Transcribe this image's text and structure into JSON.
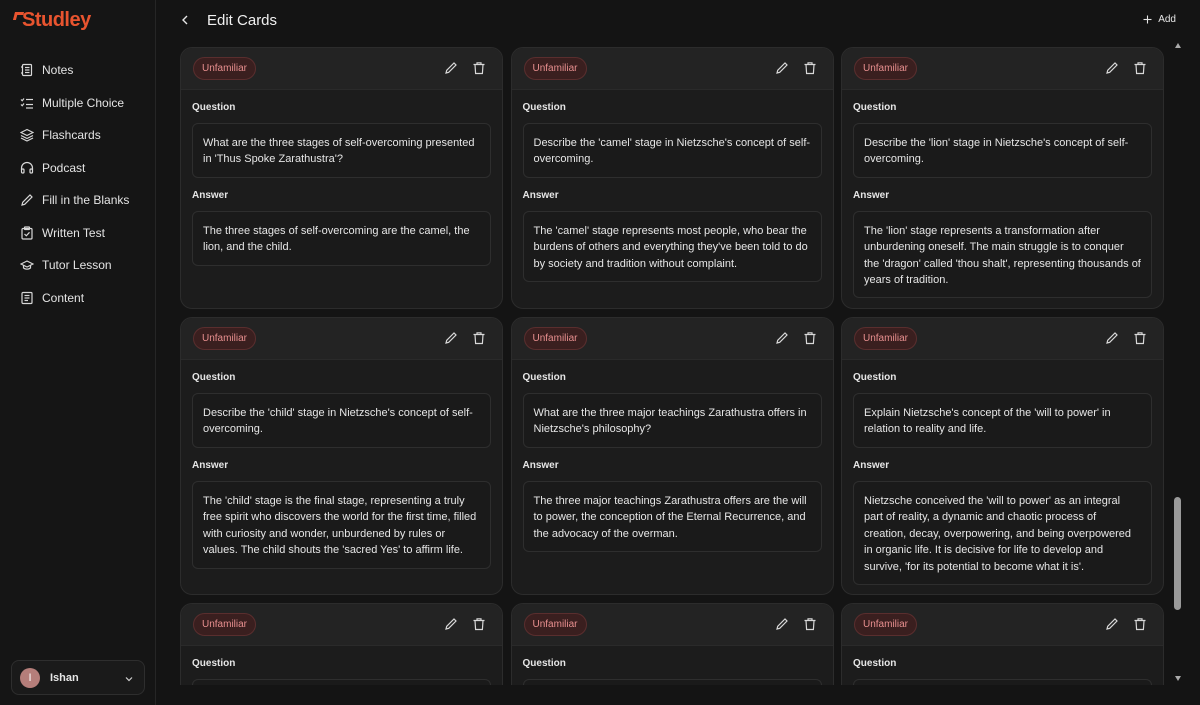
{
  "app": {
    "logo_text": "Studley"
  },
  "sidebar": {
    "items": [
      {
        "label": "Notes",
        "icon": "notes-icon"
      },
      {
        "label": "Multiple Choice",
        "icon": "checklist-icon"
      },
      {
        "label": "Flashcards",
        "icon": "layers-icon"
      },
      {
        "label": "Podcast",
        "icon": "headphones-icon"
      },
      {
        "label": "Fill in the Blanks",
        "icon": "pencil-icon"
      },
      {
        "label": "Written Test",
        "icon": "clipboard-check-icon"
      },
      {
        "label": "Tutor Lesson",
        "icon": "graduation-cap-icon"
      },
      {
        "label": "Content",
        "icon": "document-icon"
      }
    ],
    "user": {
      "initial": "I",
      "name": "Ishan"
    }
  },
  "header": {
    "title": "Edit Cards",
    "add_label": "Add"
  },
  "labels": {
    "question": "Question",
    "answer": "Answer"
  },
  "colors": {
    "accent": "#e8542f",
    "badge_bg": "#3a1f1f",
    "badge_text": "#e88f8f"
  },
  "cards": [
    {
      "status": "Unfamiliar",
      "question": "What are the three stages of self-overcoming presented in 'Thus Spoke Zarathustra'?",
      "answer": "The three stages of self-overcoming are the camel, the lion, and the child."
    },
    {
      "status": "Unfamiliar",
      "question": "Describe the 'camel' stage in Nietzsche's concept of self-overcoming.",
      "answer": "The 'camel' stage represents most people, who bear the burdens of others and everything they've been told to do by society and tradition without complaint."
    },
    {
      "status": "Unfamiliar",
      "question": "Describe the 'lion' stage in Nietzsche's concept of self-overcoming.",
      "answer": "The 'lion' stage represents a transformation after unburdening oneself. The main struggle is to conquer the 'dragon' called 'thou shalt', representing thousands of years of tradition."
    },
    {
      "status": "Unfamiliar",
      "question": "Describe the 'child' stage in Nietzsche's concept of self-overcoming.",
      "answer": "The 'child' stage is the final stage, representing a truly free spirit who discovers the world for the first time, filled with curiosity and wonder, unburdened by rules or values. The child shouts the 'sacred Yes' to affirm life."
    },
    {
      "status": "Unfamiliar",
      "question": "What are the three major teachings Zarathustra offers in Nietzsche's philosophy?",
      "answer": "The three major teachings Zarathustra offers are the will to power, the conception of the Eternal Recurrence, and the advocacy of the overman."
    },
    {
      "status": "Unfamiliar",
      "question": "Explain Nietzsche's concept of the 'will to power' in relation to reality and life.",
      "answer": "Nietzsche conceived the 'will to power' as an integral part of reality, a dynamic and chaotic process of creation, decay, overpowering, and being overpowered in organic life. It is decisive for life to develop and survive, 'for its potential to become what it is'."
    },
    {
      "status": "Unfamiliar"
    },
    {
      "status": "Unfamiliar"
    },
    {
      "status": "Unfamiliar"
    }
  ]
}
